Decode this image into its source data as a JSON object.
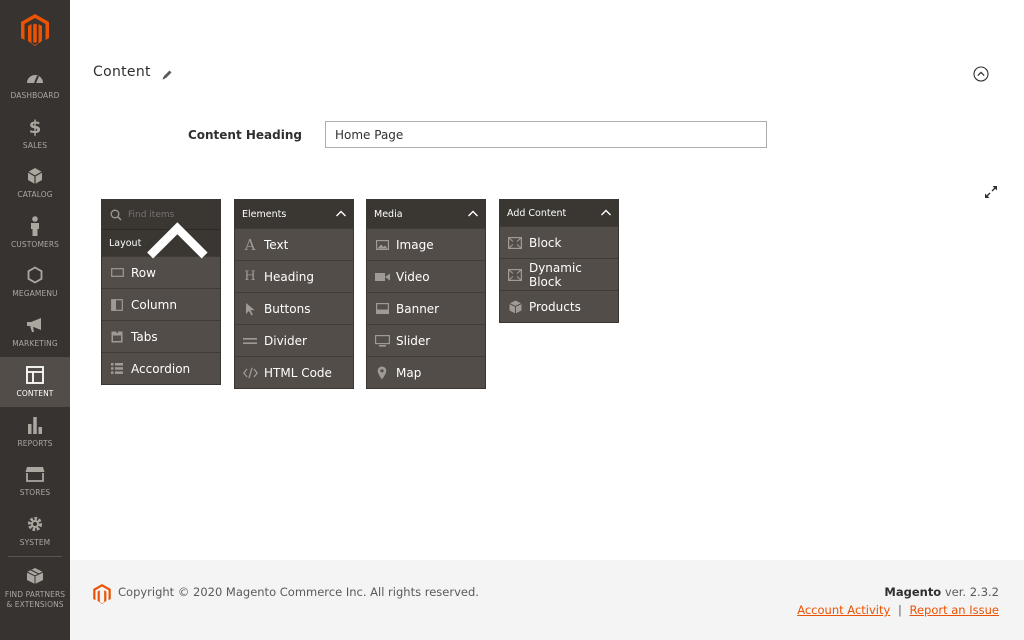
{
  "sidebar": {
    "items": [
      {
        "label": "DASHBOARD",
        "icon": "dashboard-icon"
      },
      {
        "label": "SALES",
        "icon": "dollar-icon"
      },
      {
        "label": "CATALOG",
        "icon": "cube-icon"
      },
      {
        "label": "CUSTOMERS",
        "icon": "person-icon"
      },
      {
        "label": "MEGAMENU",
        "icon": "hexagon-icon"
      },
      {
        "label": "MARKETING",
        "icon": "megaphone-icon"
      },
      {
        "label": "CONTENT",
        "icon": "layout-icon",
        "active": true
      },
      {
        "label": "REPORTS",
        "icon": "bar-chart-icon"
      },
      {
        "label": "STORES",
        "icon": "store-icon"
      },
      {
        "label": "SYSTEM",
        "icon": "gear-icon"
      }
    ],
    "partners": {
      "line1": "FIND PARTNERS",
      "line2": "& EXTENSIONS"
    }
  },
  "section": {
    "title": "Content"
  },
  "form": {
    "heading_label": "Content Heading",
    "heading_value": "Home Page"
  },
  "panels": {
    "search_placeholder": "Find items",
    "layout": {
      "title": "Layout",
      "items": [
        "Row",
        "Column",
        "Tabs",
        "Accordion"
      ]
    },
    "elements": {
      "title": "Elements",
      "items": [
        "Text",
        "Heading",
        "Buttons",
        "Divider",
        "HTML Code"
      ]
    },
    "media": {
      "title": "Media",
      "items": [
        "Image",
        "Video",
        "Banner",
        "Slider",
        "Map"
      ]
    },
    "add_content": {
      "title": "Add Content",
      "items": [
        "Block",
        "Dynamic Block",
        "Products"
      ]
    }
  },
  "footer": {
    "copyright": "Copyright © 2020 Magento Commerce Inc. All rights reserved.",
    "brand": "Magento",
    "version": " ver. 2.3.2",
    "link_activity": "Account Activity",
    "separator": "|",
    "link_issue": "Report an Issue"
  },
  "colors": {
    "accent": "#eb5202",
    "sidebar": "#373330",
    "panel": "#524d49",
    "panel_head": "#3a3632"
  }
}
